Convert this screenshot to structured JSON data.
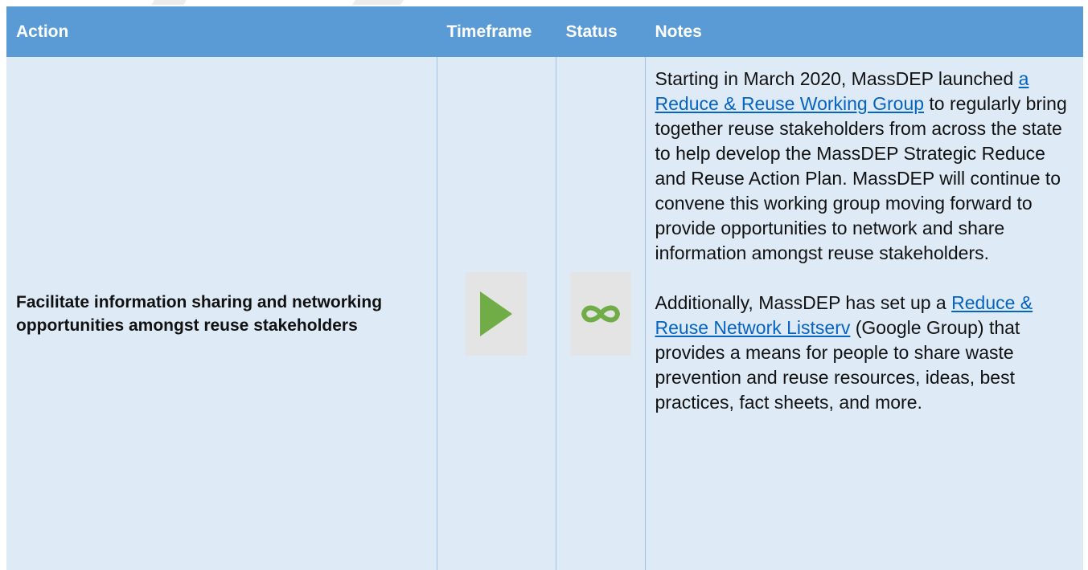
{
  "table": {
    "headers": {
      "action": "Action",
      "timeframe": "Timeframe",
      "status": "Status",
      "notes": "Notes"
    },
    "row": {
      "action": "Facilitate information sharing and networking opportunities amongst reuse stakeholders",
      "timeframe_icon": "play-icon",
      "status_icon": "infinity-icon",
      "icon_color": "#70ad47",
      "notes": {
        "p1_before": "Starting in March 2020, MassDEP launched ",
        "p1_link": "a Reduce & Reuse Working Group",
        "p1_after": " to regularly bring together reuse stakeholders from across the state to help develop the MassDEP Strategic Reduce and Reuse Action Plan. MassDEP will continue to convene this working group moving forward to provide opportunities to network and share information amongst reuse stakeholders.",
        "p2_before": "Additionally, MassDEP has set up a ",
        "p2_link": "Reduce & Reuse Network Listserv",
        "p2_after": " (Google Group) that provides a means for people to share waste prevention and reuse resources, ideas, best practices, fact sheets, and more."
      }
    }
  },
  "colors": {
    "header_bg": "#5b9bd5",
    "row_bg": "#deebf7",
    "link": "#0563c1"
  }
}
